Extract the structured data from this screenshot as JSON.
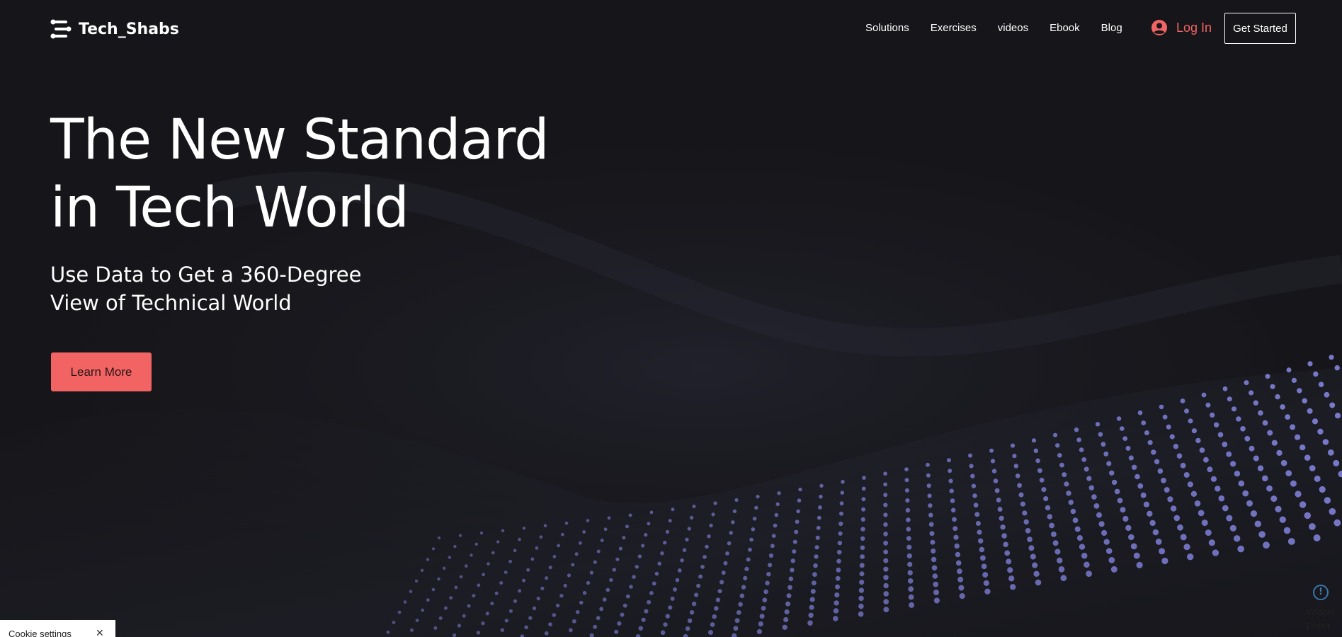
{
  "brand": {
    "name": "Tech_Shabs",
    "accent_color": "#f26464"
  },
  "nav": {
    "items": [
      {
        "label": "Solutions"
      },
      {
        "label": "Exercises"
      },
      {
        "label": "videos"
      },
      {
        "label": "Ebook"
      },
      {
        "label": "Blog"
      }
    ],
    "login_label": "Log In",
    "login_icon": "user-avatar-icon",
    "cta_label": "Get Started"
  },
  "hero": {
    "title_line1": "The New Standard",
    "title_line2": "in Tech World",
    "subtitle_line1": "Use Data to Get a 360-Degree",
    "subtitle_line2": "View of Technical World",
    "button_label": "Learn More"
  },
  "cookie": {
    "label": "Cookie settings",
    "close_icon": "close-icon"
  },
  "widget": {
    "icon": "alert-icon",
    "line1": "Widget",
    "line2": "Didn't"
  },
  "colors": {
    "background": "#16161a",
    "particles": "#8c8ef0",
    "accent": "#f26464"
  }
}
